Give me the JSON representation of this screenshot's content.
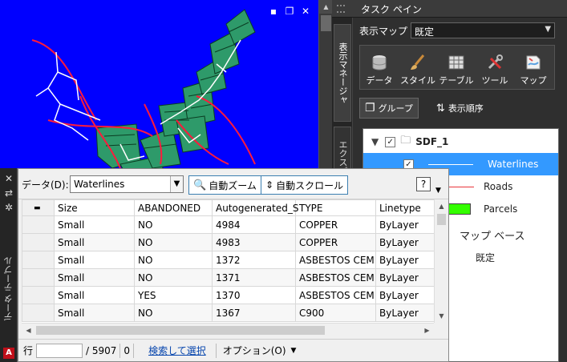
{
  "map": {
    "controls": {
      "minimize": "▪",
      "restore": "❐",
      "close": "✕"
    },
    "colors": {
      "background": "#0000ff",
      "parcels": "#2e9a6a",
      "roads": "#ff1a3c",
      "waterlines": "#ffffff"
    }
  },
  "task_pane": {
    "title": "タスク ペイン",
    "tabs": [
      "表示マネージャ",
      "エクスプロ..."
    ],
    "display_map": {
      "label": "表示マップ",
      "value": "既定"
    },
    "ribbon": [
      {
        "label": "データ",
        "icon": "database-icon"
      },
      {
        "label": "スタイル",
        "icon": "brush-icon"
      },
      {
        "label": "テーブル",
        "icon": "table-icon"
      },
      {
        "label": "ツール",
        "icon": "tools-icon"
      },
      {
        "label": "マップ",
        "icon": "map-icon"
      }
    ],
    "group_button": "グループ",
    "draw_order_button": "表示順序",
    "tree": {
      "root": "SDF_1",
      "layers": [
        {
          "name": "Waterlines",
          "checked": true,
          "color": "#ffffff"
        },
        {
          "name": "Roads",
          "checked": false,
          "color": "#e8343a"
        },
        {
          "name": "Parcels",
          "checked": false,
          "color": "#33ff00"
        }
      ],
      "map_base": "マップ ベース",
      "default_label": "既定"
    }
  },
  "data_table": {
    "vertical_title": "データ テーブル",
    "data_label": "データ(D):",
    "layer": "Waterlines",
    "auto_zoom": "自動ズーム",
    "auto_scroll": "自動スクロール",
    "help": "?",
    "columns": [
      "Size",
      "ABANDONED",
      "Autogenerated_S",
      "TYPE",
      "Linetype"
    ],
    "rows": [
      [
        "Small",
        "NO",
        "4984",
        "COPPER",
        "ByLayer"
      ],
      [
        "Small",
        "NO",
        "4983",
        "COPPER",
        "ByLayer"
      ],
      [
        "Small",
        "NO",
        "1372",
        "ASBESTOS CEM...",
        "ByLayer"
      ],
      [
        "Small",
        "NO",
        "1371",
        "ASBESTOS CEM...",
        "ByLayer"
      ],
      [
        "Small",
        "YES",
        "1370",
        "ASBESTOS CEM...",
        "ByLayer"
      ],
      [
        "Small",
        "NO",
        "1367",
        "C900",
        "ByLayer"
      ]
    ],
    "status": {
      "row_label": "行",
      "total": "/ 5907",
      "selected_count": "0",
      "search_select": "検索して選択",
      "options": "オプション(O)"
    }
  }
}
